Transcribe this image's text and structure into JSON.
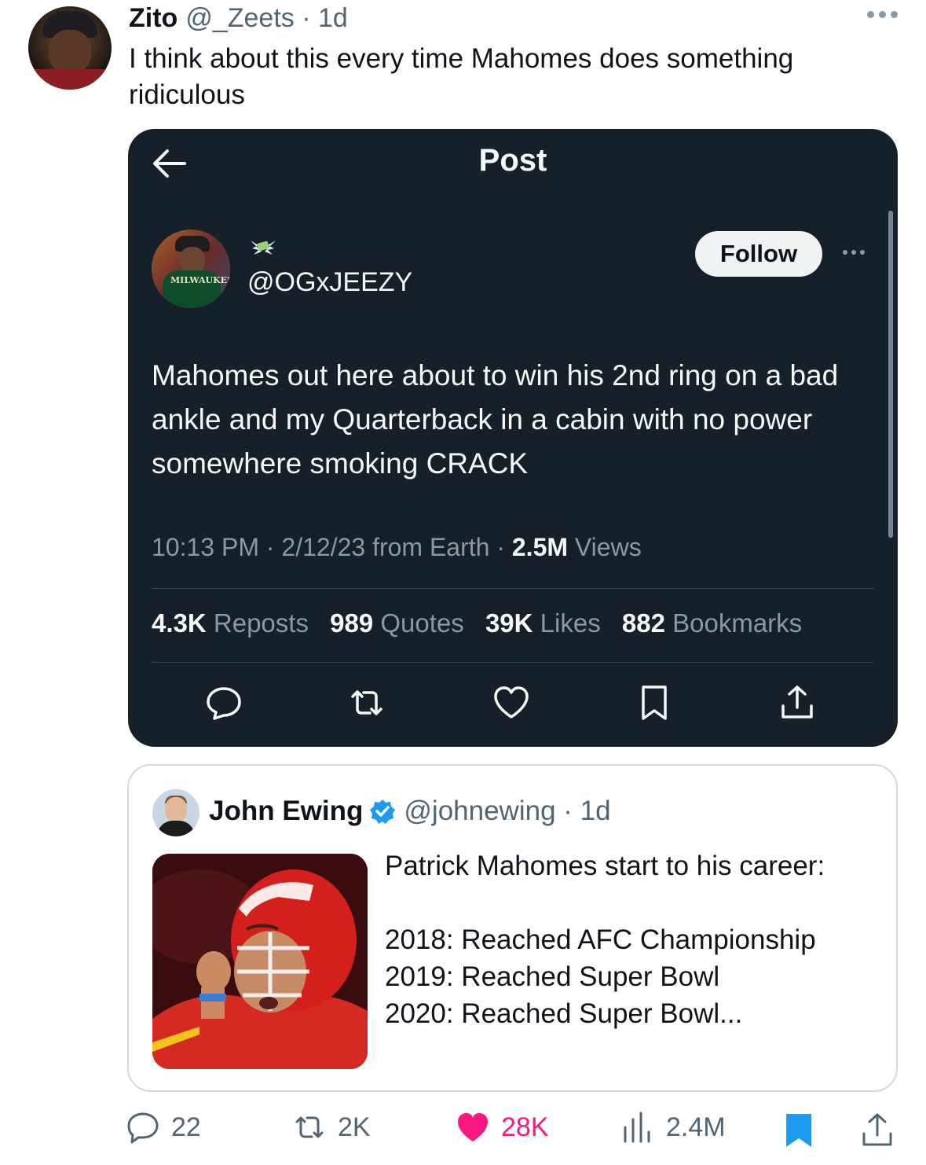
{
  "tweet": {
    "author_name": "Zito",
    "author_handle": "@_Zeets",
    "separator": "·",
    "age": "1d",
    "text": "I think about this every time Mahomes does something ridiculous"
  },
  "embedded_screenshot": {
    "title": "Post",
    "handle": "@OGxJEEZY",
    "follow_label": "Follow",
    "avatar_jersey_text": "MILWAUKEE",
    "text": "Mahomes out here about to win his 2nd ring on a bad ankle and my Quarterback in a cabin with no power somewhere smoking CRACK",
    "timestamp": "10:13 PM · 2/12/23 from Earth · ",
    "views_count": "2.5M",
    "views_label": " Views",
    "stats": [
      {
        "count": "4.3K",
        "label": "Reposts"
      },
      {
        "count": "989",
        "label": "Quotes"
      },
      {
        "count": "39K",
        "label": "Likes"
      },
      {
        "count": "882",
        "label": "Bookmarks"
      }
    ],
    "actions": [
      "reply-icon",
      "repost-icon",
      "like-icon",
      "bookmark-icon",
      "share-icon"
    ]
  },
  "quoted_tweet": {
    "author_name": "John Ewing",
    "verified": true,
    "meta": "@johnewing · 1d",
    "text": "Patrick Mahomes start to his career:\n\n2018: Reached AFC Championship\n2019: Reached Super Bowl\n2020: Reached Super Bowl...",
    "image": "photo of Patrick Mahomes in red Chiefs helmet and jersey"
  },
  "action_bar": {
    "replies": "22",
    "reposts": "2K",
    "likes": "28K",
    "views": "2.4M",
    "liked": true,
    "bookmarked": true
  },
  "colors": {
    "like": "#f91880",
    "verified": "#1d9bf0",
    "bookmark": "#1d9bf0",
    "dark_bg": "#15202b",
    "secondary_text": "#536471"
  }
}
